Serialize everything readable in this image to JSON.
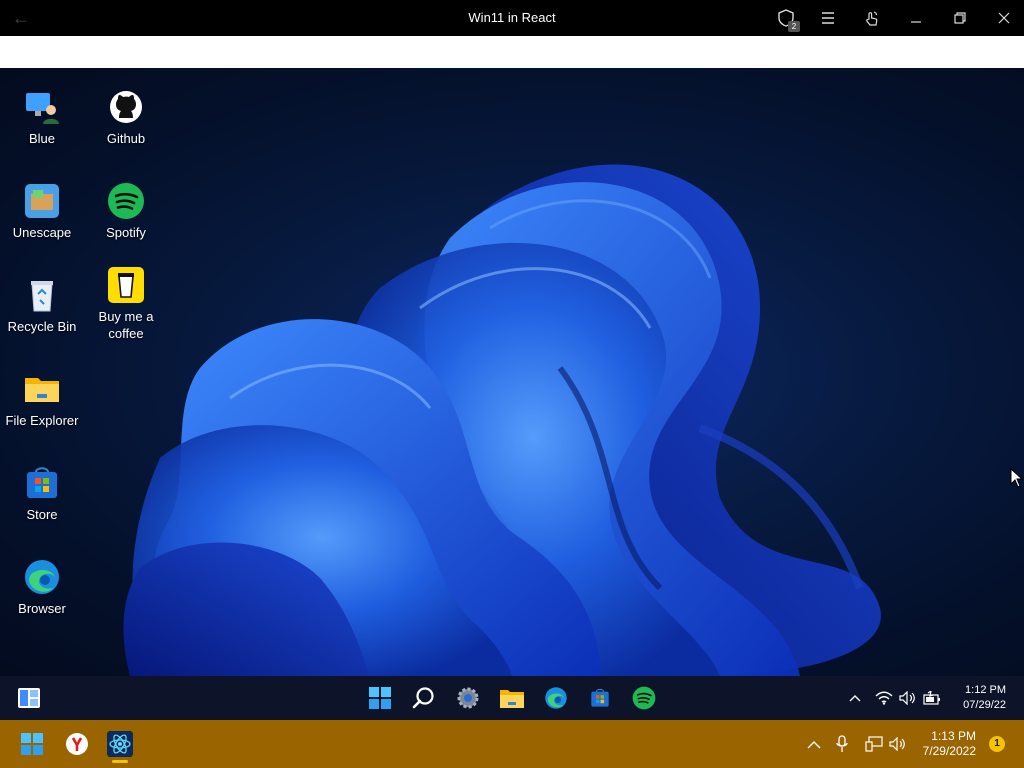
{
  "window": {
    "title": "Win11 in React",
    "notification_count": "2"
  },
  "desktop": {
    "icons": [
      {
        "label": "Blue",
        "icon": "monitor-user-icon"
      },
      {
        "label": "Github",
        "icon": "github-icon"
      },
      {
        "label": "Unescape",
        "icon": "unescape-icon"
      },
      {
        "label": "Spotify",
        "icon": "spotify-icon"
      },
      {
        "label": "Recycle Bin",
        "icon": "recycle-bin-icon"
      },
      {
        "label": "Buy me a coffee",
        "icon": "coffee-cup-icon"
      },
      {
        "label": "File Explorer",
        "icon": "folder-icon"
      },
      {
        "label": "Store",
        "icon": "store-icon"
      },
      {
        "label": "Browser",
        "icon": "edge-icon"
      }
    ]
  },
  "taskbar": {
    "apps": [
      "widgets-icon",
      "start-icon",
      "search-icon",
      "settings-icon",
      "file-explorer-icon",
      "edge-icon",
      "store-icon",
      "spotify-icon"
    ],
    "time": "1:12 PM",
    "date": "07/29/22"
  },
  "hostbar": {
    "apps": [
      "start-icon",
      "yandex-icon",
      "win11-react-app-icon"
    ],
    "time": "1:13 PM",
    "date": "7/29/2022",
    "notifications": "1"
  },
  "colors": {
    "hostbar_bg": "#9a6400",
    "accent_blue": "#1f6fd9",
    "spotify_green": "#1db954"
  }
}
